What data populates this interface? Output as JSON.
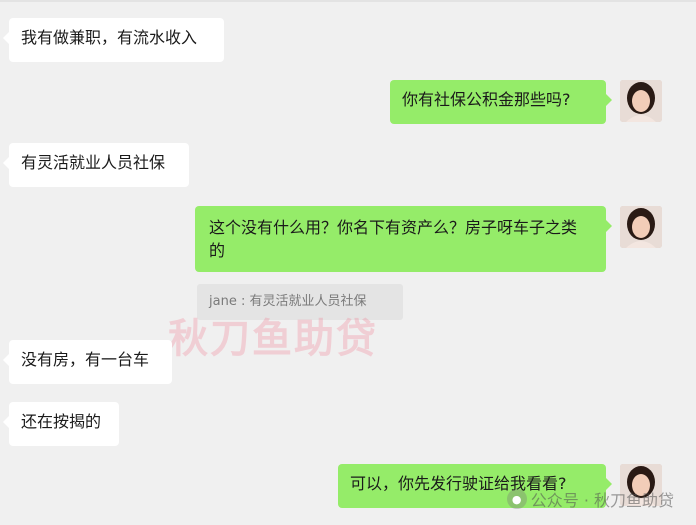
{
  "colors": {
    "incoming_bubble": "#ffffff",
    "outgoing_bubble": "#95ec69",
    "background": "#f0f0f0"
  },
  "messages": [
    {
      "side": "left",
      "text": "我有做兼职，有流水收入"
    },
    {
      "side": "right",
      "text": "你有社保公积金那些吗?"
    },
    {
      "side": "left",
      "text": "有灵活就业人员社保"
    },
    {
      "side": "right",
      "text": "这个没有什么用？你名下有资产么？房子呀车子之类的"
    },
    {
      "side": "left",
      "text": "没有房，有一台车"
    },
    {
      "side": "left",
      "text": "还在按揭的"
    },
    {
      "side": "right",
      "text": "可以，你先发行驶证给我看看?"
    }
  ],
  "quote": {
    "text": "jane : 有灵活就业人员社保"
  },
  "watermark": {
    "text": "秋刀鱼助贷"
  },
  "footer": {
    "icon": "wechat-icon",
    "text": "公众号 · 秋刀鱼助贷"
  }
}
